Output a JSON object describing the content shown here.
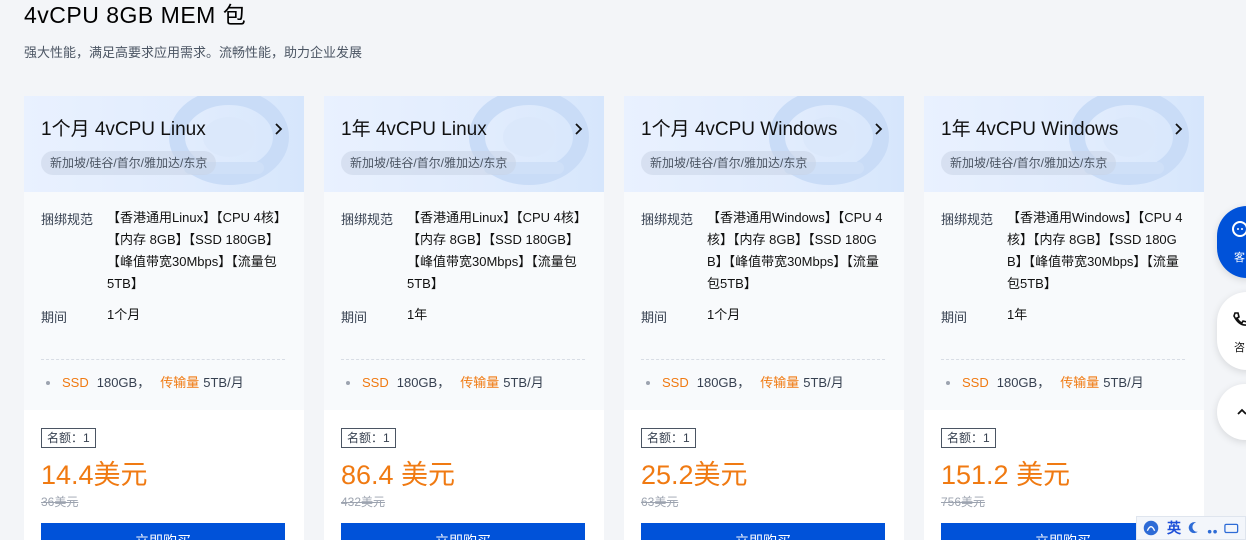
{
  "header": {
    "title": "4vCPU 8GB  MEM 包",
    "subtitle": "强大性能，满足高要求应用需求。流畅性能，助力企业发展"
  },
  "labels": {
    "spec": "捆绑规范",
    "period": "期间",
    "quota": "名额：1",
    "buy": "立即购买",
    "ssd": "SSD",
    "transfer": "传输量"
  },
  "cards": [
    {
      "title": "1个月 4vCPU Linux",
      "regions": "新加坡/硅谷/首尔/雅加达/东京",
      "spec": "【香港通用Linux】【CPU 4核】【内存 8GB】【SSD 180GB】【峰值带宽30Mbps】【流量包5TB】",
      "period": "1个月",
      "ssd_value": "180GB，",
      "transfer_value": "5TB/月",
      "price": "14.4美元",
      "old_price": "36美元"
    },
    {
      "title": "1年 4vCPU Linux",
      "regions": "新加坡/硅谷/首尔/雅加达/东京",
      "spec": "【香港通用Linux】【CPU 4核】【内存 8GB】【SSD 180GB】【峰值带宽30Mbps】【流量包5TB】",
      "period": "1年",
      "ssd_value": "180GB，",
      "transfer_value": "5TB/月",
      "price": "86.4 美元",
      "old_price": "432美元"
    },
    {
      "title": "1个月 4vCPU Windows",
      "regions": "新加坡/硅谷/首尔/雅加达/东京",
      "spec": "【香港通用Windows】【CPU 4核】【内存 8GB】【SSD 180GB】【峰值带宽30Mbps】【流量包5TB】",
      "period": "1个月",
      "ssd_value": "180GB，",
      "transfer_value": "5TB/月",
      "price": "25.2美元",
      "old_price": "63美元"
    },
    {
      "title": "1年 4vCPU Windows",
      "regions": "新加坡/硅谷/首尔/雅加达/东京",
      "spec": "【香港通用Windows】【CPU 4核】【内存 8GB】【SSD 180GB】【峰值带宽30Mbps】【流量包5TB】",
      "period": "1年",
      "ssd_value": "180GB，",
      "transfer_value": "5TB/月",
      "price": "151.2 美元",
      "old_price": "756美元"
    }
  ],
  "float_buttons": {
    "service": "客",
    "consult": "咨"
  },
  "ime": {
    "lang": "英",
    "icons": [
      "ime-logo-icon",
      "moon-icon",
      "punctuation-icon"
    ]
  },
  "colors": {
    "accent": "#0052d9",
    "price": "#f07a12"
  }
}
